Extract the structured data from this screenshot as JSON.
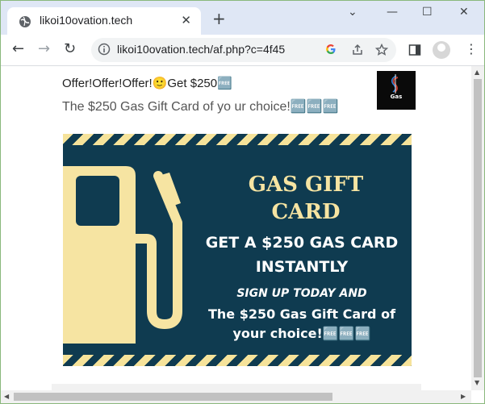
{
  "tab": {
    "title": "likoi10ovation.tech",
    "close_glyph": "✕"
  },
  "window_controls": {
    "minimize": "⌄",
    "restore": "—",
    "maximize": "☐",
    "close": "✕"
  },
  "new_tab_glyph": "+",
  "toolbar": {
    "back_glyph": "←",
    "forward_glyph": "→",
    "reload_glyph": "↻",
    "url": "likoi10ovation.tech/af.php?c=4f45",
    "menu_glyph": "⋮"
  },
  "page": {
    "heading": "Offer!Offer!Offer!🙂Get $250🆓",
    "subheading": "The $250 Gas Gift Card of yo ur choice!🆓🆓🆓",
    "thumbnail_label": "Gas"
  },
  "banner": {
    "title_line1": "GAS GIFT",
    "title_line2": "CARD",
    "offer_line1": "GET A $250 GAS CARD",
    "offer_line2": "INSTANTLY",
    "signup": "SIGN UP TODAY AND",
    "choice_line1": "The $250 Gas Gift Card of",
    "choice_line2": "your choice!🆓🆓🆓",
    "colors": {
      "background": "#0f3b50",
      "accent": "#f6e4a2"
    }
  }
}
